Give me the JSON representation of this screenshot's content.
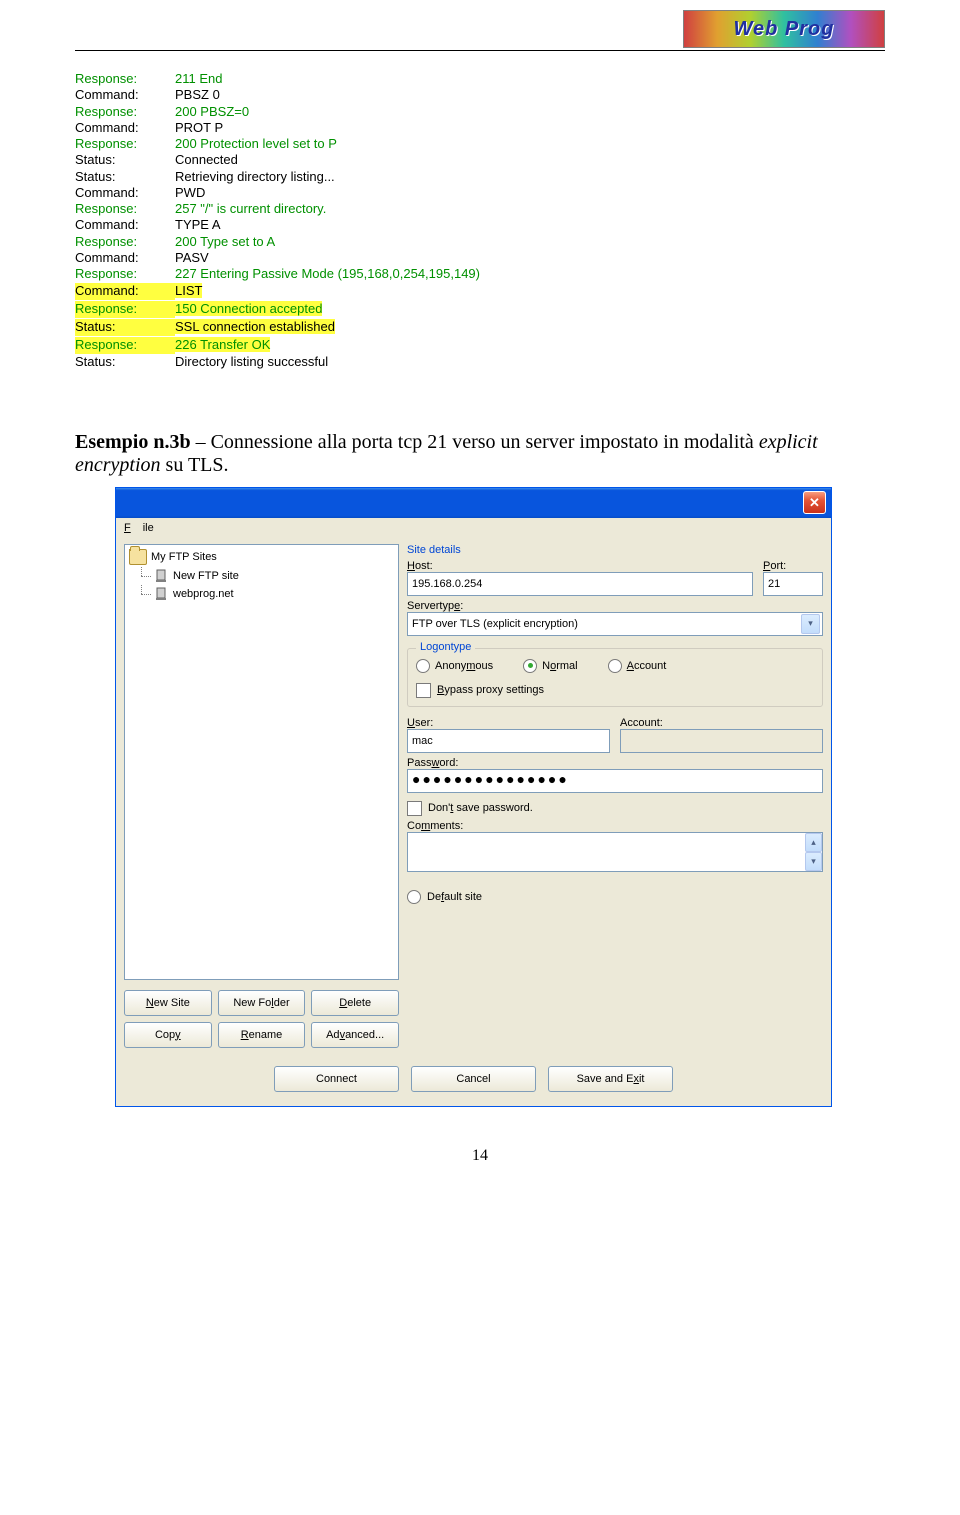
{
  "logo_text": "Web Prog",
  "log": [
    {
      "cls": "green",
      "label": "Response:",
      "text": "211 End",
      "hl": false
    },
    {
      "cls": "black",
      "label": "Command:",
      "text": "PBSZ 0",
      "hl": false
    },
    {
      "cls": "green",
      "label": "Response:",
      "text": "200 PBSZ=0",
      "hl": false
    },
    {
      "cls": "black",
      "label": "Command:",
      "text": "PROT P",
      "hl": false
    },
    {
      "cls": "green",
      "label": "Response:",
      "text": "200 Protection level set to P",
      "hl": false
    },
    {
      "cls": "black",
      "label": "Status:",
      "text": "Connected",
      "hl": false
    },
    {
      "cls": "black",
      "label": "Status:",
      "text": "Retrieving directory listing...",
      "hl": false
    },
    {
      "cls": "black",
      "label": "Command:",
      "text": "PWD",
      "hl": false
    },
    {
      "cls": "green",
      "label": "Response:",
      "text": "257 \"/\" is current directory.",
      "hl": false
    },
    {
      "cls": "black",
      "label": "Command:",
      "text": "TYPE A",
      "hl": false
    },
    {
      "cls": "green",
      "label": "Response:",
      "text": "200 Type set to A",
      "hl": false
    },
    {
      "cls": "black",
      "label": "Command:",
      "text": "PASV",
      "hl": false
    },
    {
      "cls": "green",
      "label": "Response:",
      "text": "227 Entering Passive Mode (195,168,0,254,195,149)",
      "hl": false
    },
    {
      "cls": "black",
      "label": "Command:",
      "text": "LIST",
      "hl": true
    },
    {
      "cls": "green",
      "label": "Response:",
      "text": "150 Connection accepted",
      "hl": true
    },
    {
      "cls": "black",
      "label": "Status:",
      "text": "SSL connection established",
      "hl": true
    },
    {
      "cls": "green",
      "label": "Response:",
      "text": "226 Transfer OK",
      "hl": true
    },
    {
      "cls": "black",
      "label": "Status:",
      "text": "Directory listing successful",
      "hl": false
    }
  ],
  "example": {
    "bold": "Esempio n.3b",
    "sep": " – ",
    "text1": "Connessione alla porta tcp 21 verso un server impostato in modalità ",
    "italic": "explicit encryption",
    "text2": " su TLS."
  },
  "dialog": {
    "close_glyph": "✕",
    "menu_file_html": "<span class='ul'>F</span>ile",
    "tree_root": "My FTP Sites",
    "tree_items": [
      "New FTP site",
      "webprog.net"
    ],
    "btns_left": [
      "<span class='ul'>N</span>ew Site",
      "New Fo<span class='ul'>l</span>der",
      "<span class='ul'>D</span>elete",
      "Cop<span class='ul'>y</span>",
      "<span class='ul'>R</span>ename",
      "Ad<span class='ul'>v</span>anced..."
    ],
    "site_details": "Site details",
    "host_lbl": "<span class='ul'>H</span>ost:",
    "host_val": "195.168.0.254",
    "port_lbl": "<span class='ul'>P</span>ort:",
    "port_val": "21",
    "servertype_lbl": "Servertyp<span class='ul'>e</span>:",
    "servertype_val": "FTP over TLS (explicit encryption)",
    "groupbox_title": "Logontype",
    "radios": [
      {
        "html": "Anony<span class='ul'>m</span>ous",
        "checked": false
      },
      {
        "html": "N<span class='ul'>o</span>rmal",
        "checked": true
      },
      {
        "html": "<span class='ul'>A</span>ccount",
        "checked": false
      }
    ],
    "bypass_html": "<span class='ul'>B</span>ypass proxy settings",
    "user_lbl": "<span class='ul'>U</span>ser:",
    "user_val": "mac",
    "account_lbl": "Account:",
    "pass_lbl": "Pass<span class='ul'>w</span>ord:",
    "pass_dots": "●●●●●●●●●●●●●●●",
    "dont_save_html": "Don'<span class='ul'>t</span> save password.",
    "comments_lbl": "Co<span class='ul'>m</span>ments:",
    "default_site_html": "De<span class='ul'>f</span>ault site",
    "bottom_btns": [
      "Connect",
      "Cancel",
      "Save and E<span class='ul'>x</span>it"
    ]
  },
  "page_number": "14"
}
